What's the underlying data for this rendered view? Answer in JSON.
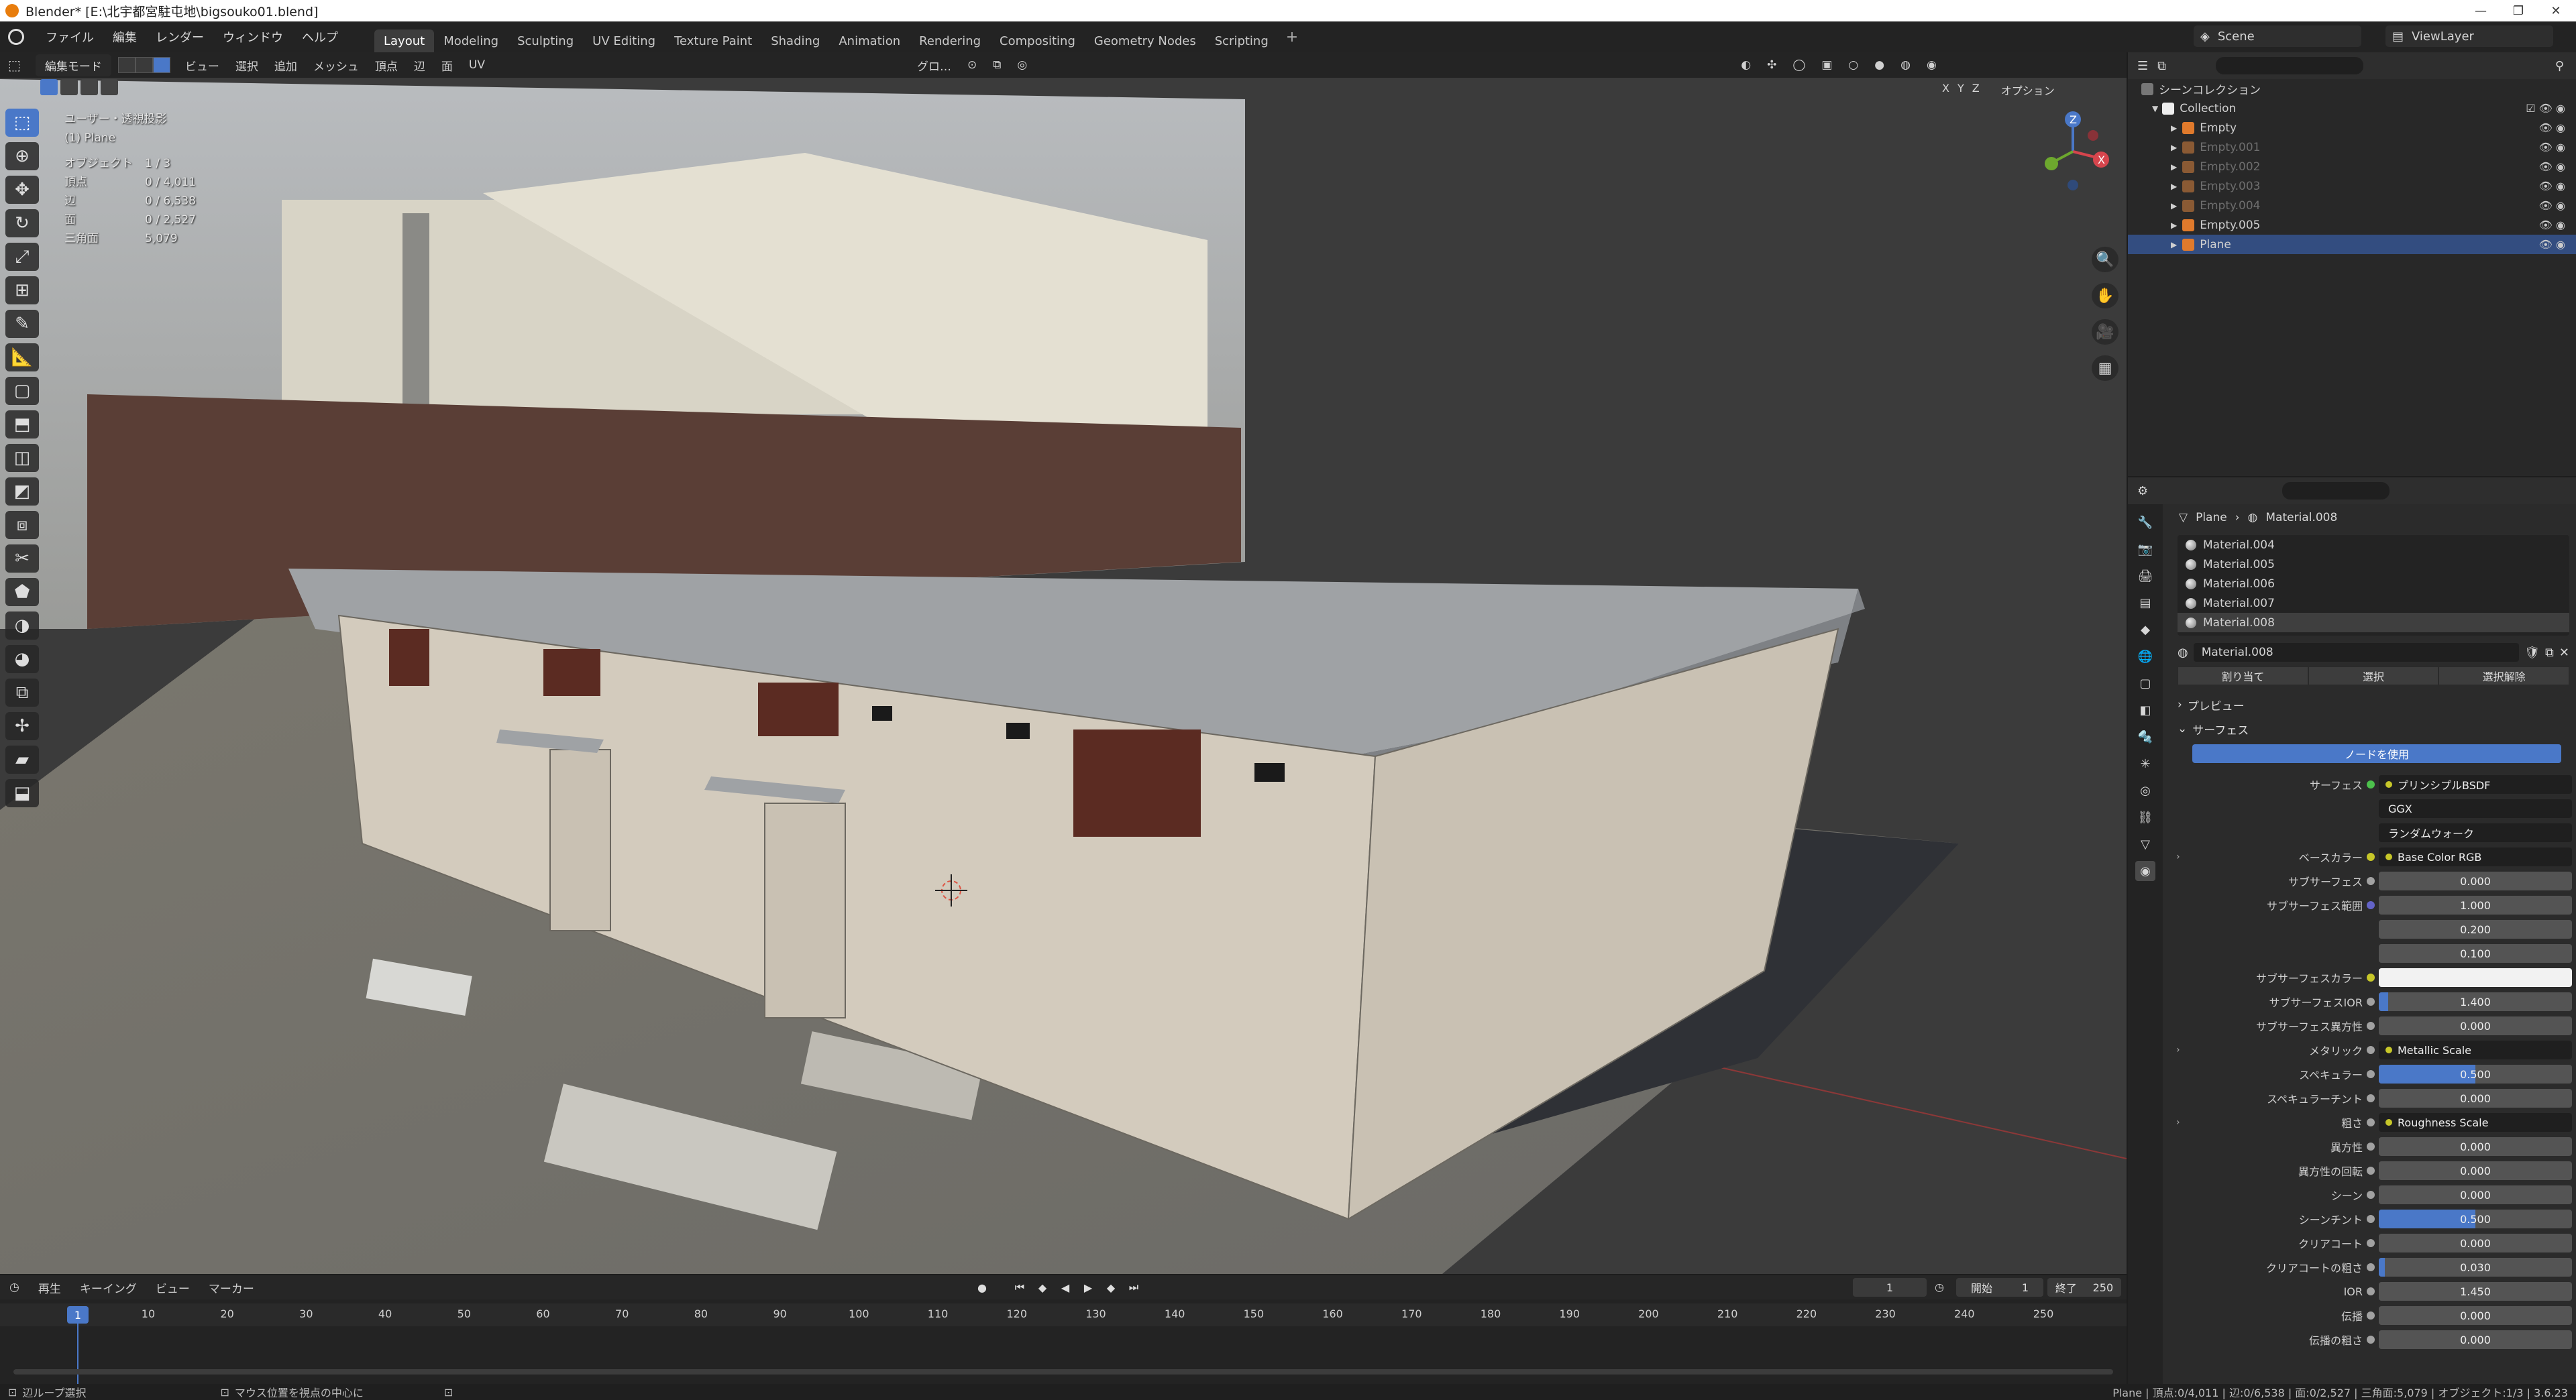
{
  "window": {
    "title": "Blender* [E:\\北宇都宮駐屯地\\bigsouko01.blend]",
    "controls": [
      "—",
      "❐",
      "✕"
    ]
  },
  "topbar": {
    "menus": [
      "ファイル",
      "編集",
      "レンダー",
      "ウィンドウ",
      "ヘルプ"
    ],
    "workspaces": [
      "Layout",
      "Modeling",
      "Sculpting",
      "UV Editing",
      "Texture Paint",
      "Shading",
      "Animation",
      "Rendering",
      "Compositing",
      "Geometry Nodes",
      "Scripting"
    ],
    "active_workspace": "Layout",
    "scene": "Scene",
    "view_layer": "ViewLayer"
  },
  "viewport": {
    "mode": "編集モード",
    "menus": [
      "ビュー",
      "選択",
      "追加",
      "メッシュ",
      "頂点",
      "辺",
      "面",
      "UV"
    ],
    "transform_orientation": "グロ…",
    "options_label": "オプション",
    "axes": [
      "X",
      "Y",
      "Z"
    ],
    "overlay_title": "ユーザー・透視投影",
    "overlay_object": "(1) Plane",
    "stats": [
      {
        "k": "オブジェクト",
        "v": "1 / 3"
      },
      {
        "k": "頂点",
        "v": "0 / 4,011"
      },
      {
        "k": "辺",
        "v": "0 / 6,538"
      },
      {
        "k": "面",
        "v": "0 / 2,527"
      },
      {
        "k": "三角面",
        "v": "5,079"
      }
    ]
  },
  "outliner": {
    "scene_collection": "シーンコレクション",
    "collection": "Collection",
    "items": [
      {
        "name": "Empty",
        "dim": false,
        "color": "#e07a2c"
      },
      {
        "name": "Empty.001",
        "dim": true,
        "color": "#8a5a34"
      },
      {
        "name": "Empty.002",
        "dim": true,
        "color": "#8a5a34"
      },
      {
        "name": "Empty.003",
        "dim": true,
        "color": "#8a5a34"
      },
      {
        "name": "Empty.004",
        "dim": true,
        "color": "#8a5a34"
      },
      {
        "name": "Empty.005",
        "dim": false,
        "color": "#e07a2c"
      },
      {
        "name": "Plane",
        "dim": false,
        "color": "#e07a2c",
        "selected": true
      }
    ]
  },
  "properties": {
    "breadcrumb_object": "Plane",
    "breadcrumb_material": "Material.008",
    "materials": [
      "Material.004",
      "Material.005",
      "Material.006",
      "Material.007",
      "Material.008"
    ],
    "selected_material": "Material.008",
    "slot_name": "Material.008",
    "buttons": [
      "割り当て",
      "選択",
      "選択解除"
    ],
    "preview_panel": "プレビュー",
    "surface_panel": "サーフェス",
    "use_nodes": "ノードを使用",
    "rows": [
      {
        "label": "サーフェス",
        "value": "プリンシプルBSDF",
        "type": "link",
        "dot": "#4cc14c"
      },
      {
        "label": "",
        "value": "GGX",
        "type": "drop"
      },
      {
        "label": "",
        "value": "ランダムウォーク",
        "type": "drop"
      },
      {
        "label": "ベースカラー",
        "value": "Base Color RGB",
        "type": "link",
        "dot": "#c7c729",
        "expand": true
      },
      {
        "label": "サブサーフェス",
        "value": "0.000",
        "type": "num",
        "fill": 0,
        "dot": "#a1a1a1"
      },
      {
        "label": "サブサーフェス範囲",
        "value": "1.000",
        "type": "num",
        "fill": 0,
        "dot": "#6363c7"
      },
      {
        "label": "",
        "value": "0.200",
        "type": "num",
        "fill": 0
      },
      {
        "label": "",
        "value": "0.100",
        "type": "num",
        "fill": 0
      },
      {
        "label": "サブサーフェスカラー",
        "value": "",
        "type": "color",
        "dot": "#c7c729"
      },
      {
        "label": "サブサーフェスIOR",
        "value": "1.400",
        "type": "num",
        "fill": 0.05,
        "dot": "#a1a1a1"
      },
      {
        "label": "サブサーフェス異方性",
        "value": "0.000",
        "type": "num",
        "fill": 0,
        "dot": "#a1a1a1"
      },
      {
        "label": "メタリック",
        "value": "Metallic Scale",
        "type": "link",
        "dot": "#a1a1a1",
        "expand": true
      },
      {
        "label": "スペキュラー",
        "value": "0.500",
        "type": "num",
        "fill": 0.5,
        "dot": "#a1a1a1"
      },
      {
        "label": "スペキュラーチント",
        "value": "0.000",
        "type": "num",
        "fill": 0,
        "dot": "#a1a1a1"
      },
      {
        "label": "粗さ",
        "value": "Roughness Scale",
        "type": "link",
        "dot": "#a1a1a1",
        "expand": true
      },
      {
        "label": "異方性",
        "value": "0.000",
        "type": "num",
        "fill": 0,
        "dot": "#a1a1a1"
      },
      {
        "label": "異方性の回転",
        "value": "0.000",
        "type": "num",
        "fill": 0,
        "dot": "#a1a1a1"
      },
      {
        "label": "シーン",
        "value": "0.000",
        "type": "num",
        "fill": 0,
        "dot": "#a1a1a1"
      },
      {
        "label": "シーンチント",
        "value": "0.500",
        "type": "num",
        "fill": 0.5,
        "dot": "#a1a1a1"
      },
      {
        "label": "クリアコート",
        "value": "0.000",
        "type": "num",
        "fill": 0,
        "dot": "#a1a1a1"
      },
      {
        "label": "クリアコートの粗さ",
        "value": "0.030",
        "type": "num",
        "fill": 0.03,
        "dot": "#a1a1a1"
      },
      {
        "label": "IOR",
        "value": "1.450",
        "type": "num",
        "fill": 0,
        "dot": "#a1a1a1"
      },
      {
        "label": "伝播",
        "value": "0.000",
        "type": "num",
        "fill": 0,
        "dot": "#a1a1a1"
      },
      {
        "label": "伝播の粗さ",
        "value": "0.000",
        "type": "num",
        "fill": 0,
        "dot": "#a1a1a1"
      }
    ]
  },
  "timeline": {
    "menus": [
      "再生",
      "キーイング",
      "ビュー",
      "マーカー"
    ],
    "current_frame": "1",
    "start_label": "開始",
    "start": "1",
    "end_label": "終了",
    "end": "250",
    "ticks": [
      "10",
      "20",
      "30",
      "40",
      "50",
      "60",
      "70",
      "80",
      "90",
      "100",
      "110",
      "120",
      "130",
      "140",
      "150",
      "160",
      "170",
      "180",
      "190",
      "200",
      "210",
      "220",
      "230",
      "240",
      "250"
    ],
    "playhead_label": "1"
  },
  "statusbar": {
    "left": "辺ループ選択",
    "middle": "マウス位置を視点の中心に",
    "right": "Plane | 頂点:0/4,011 | 辺:0/6,538 | 面:0/2,527 | 三角面:5,079 | オブジェクト:1/3 | 3.6.23"
  }
}
